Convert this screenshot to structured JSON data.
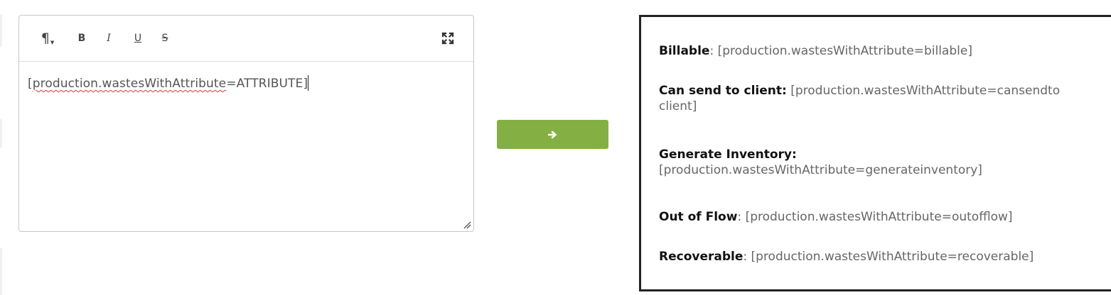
{
  "editor": {
    "toolbar": {
      "paragraph_icon": "pilcrow-icon",
      "bold_label": "B",
      "italic_label": "I",
      "underline_label": "U",
      "strike_label": "S",
      "fullscreen_icon": "expand-icon"
    },
    "content": {
      "prefix": "[",
      "misspelled": "production.wastesWithAttribute",
      "suffix": "=ATTRIBUTE]"
    }
  },
  "convert_button": {
    "icon": "arrow-right-icon",
    "label": "→"
  },
  "preview": {
    "rows": [
      {
        "label": "Billable",
        "separator": ": ",
        "value": "[production.wastesWithAttribute=billable]"
      },
      {
        "label": "Can send to client:",
        "separator": " ",
        "value": "[production.wastesWithAttribute=cansendto",
        "value_line2": "client]"
      },
      {
        "label": "Generate Inventory:",
        "value": "[production.wastesWithAttribute=generateinventory]"
      },
      {
        "label": "Out of Flow",
        "separator": ": ",
        "value": "[production.wastesWithAttribute=outofflow]"
      },
      {
        "label": "Recoverable",
        "separator": ": ",
        "value": "[production.wastesWithAttribute=recoverable]"
      }
    ]
  },
  "colors": {
    "accent": "#84b043",
    "border": "#222222",
    "spellcheck": "#e53935"
  }
}
